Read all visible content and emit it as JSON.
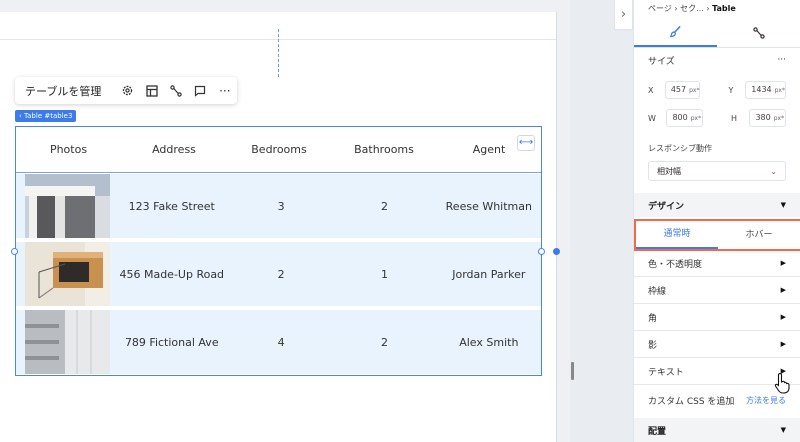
{
  "toolbar": {
    "manage_label": "テーブルを管理",
    "icons": [
      "gear-icon",
      "layout-icon",
      "connect-icon",
      "comment-icon",
      "more-icon"
    ],
    "more_glyph": "···"
  },
  "selection_tag": "‹ Table #table3",
  "table": {
    "columns": [
      "Photos",
      "Address",
      "Bedrooms",
      "Bathrooms",
      "Agent"
    ],
    "rows": [
      {
        "address": "123 Fake Street",
        "bedrooms": "3",
        "bathrooms": "2",
        "agent": "Reese Whitman"
      },
      {
        "address": "456 Made-Up Road",
        "bedrooms": "2",
        "bathrooms": "1",
        "agent": "Jordan Parker"
      },
      {
        "address": "789 Fictional Ave",
        "bedrooms": "4",
        "bathrooms": "2",
        "agent": "Alex Smith"
      }
    ]
  },
  "panel": {
    "breadcrumb": {
      "first": "ページ",
      "second": "セク...",
      "current": "Table"
    },
    "tabs": [
      "design-brush-icon",
      "connect-icon"
    ],
    "size_label": "サイズ",
    "size_more": "···",
    "x_label": "X",
    "x_value": "457",
    "y_label": "Y",
    "y_value": "1434",
    "w_label": "W",
    "w_value": "800",
    "h_label": "H",
    "h_value": "380",
    "unit": "px*",
    "responsive_label": "レスポンシブ動作",
    "responsive_value": "相対幅",
    "design_label": "デザイン",
    "state_normal": "通常時",
    "state_hover": "ホバー",
    "properties": [
      "色・不透明度",
      "枠線",
      "角",
      "影",
      "テキスト"
    ],
    "custom_css_label": "カスタム CSS を追加",
    "custom_css_link": "方法を見る",
    "arrangement_label": "配置"
  },
  "colors": {
    "accent": "#3b7bea",
    "highlight_border": "#f26a47",
    "row_bg": "#e8f3fd"
  }
}
